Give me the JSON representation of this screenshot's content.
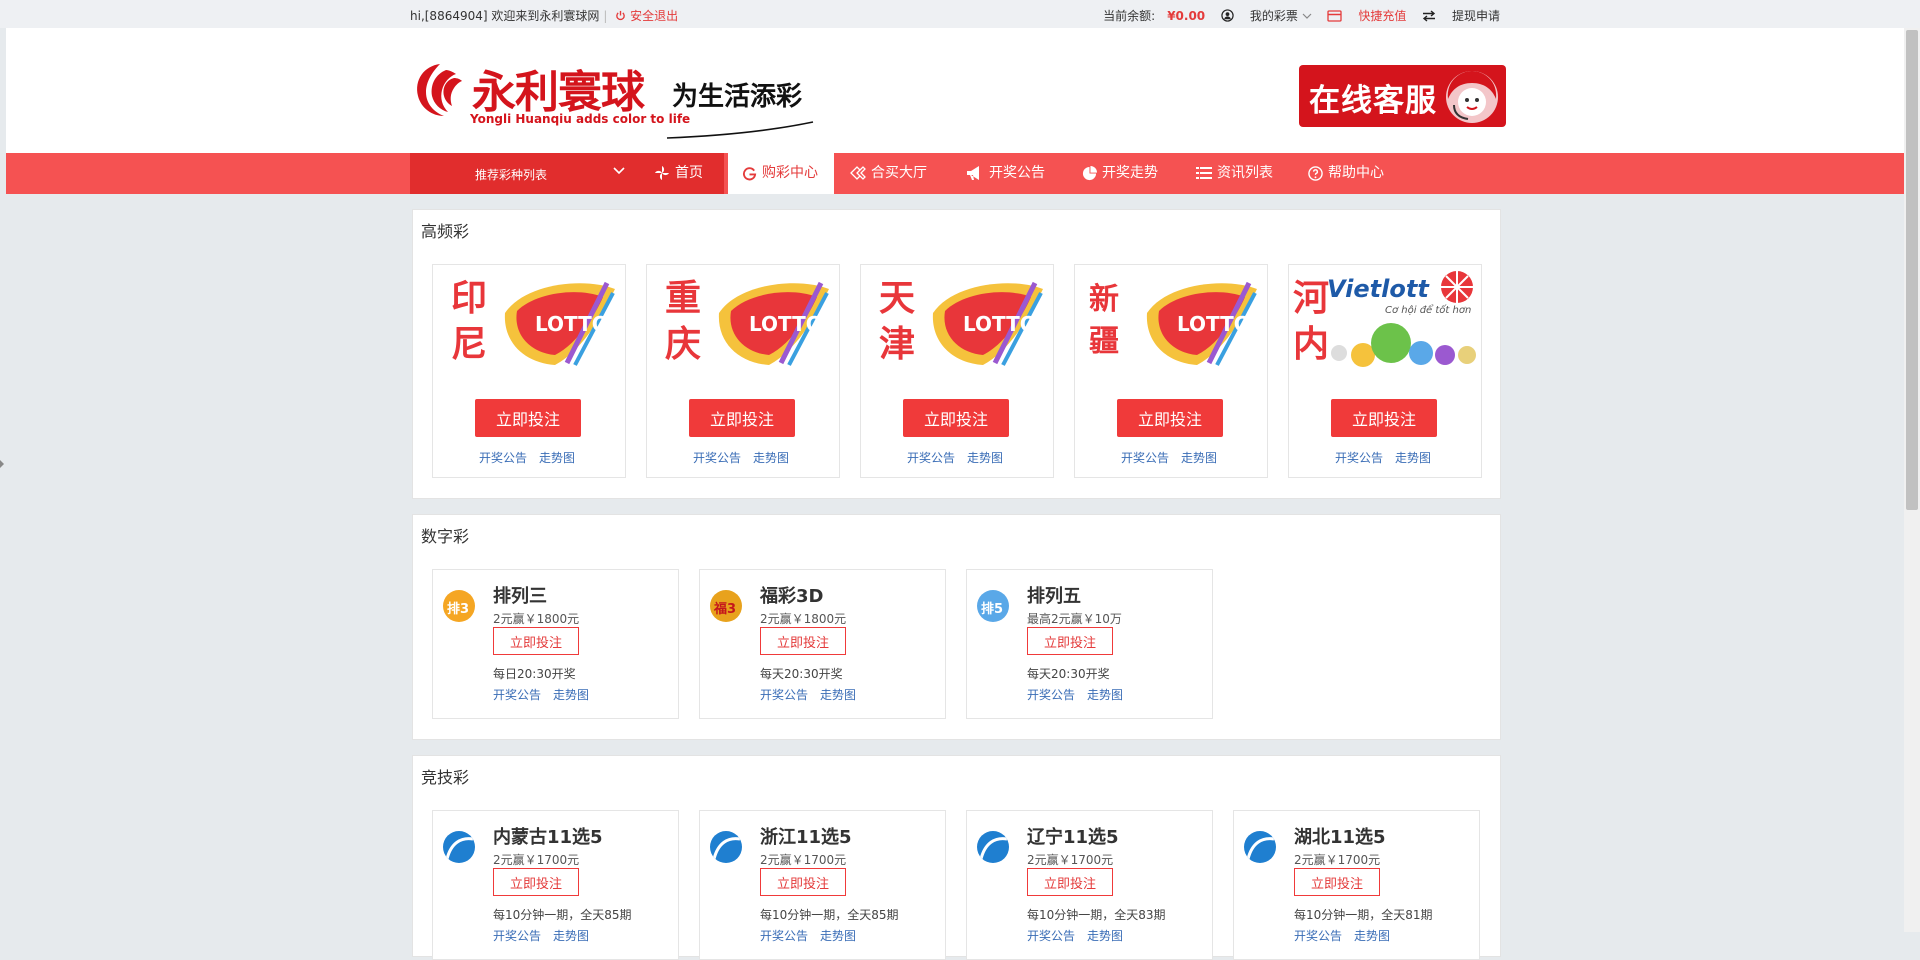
{
  "topbar": {
    "greeting": "hi,[8864904] 欢迎来到永利寰球网",
    "logout": "安全退出",
    "balance_label": "当前余额:",
    "balance_value": "¥0.00",
    "my_lottery": "我的彩票",
    "recharge": "快捷充值",
    "withdraw": "提现申请"
  },
  "logo": {
    "cn": "永利寰球",
    "en": "Yongli Huanqiu adds color to life",
    "slogan": "为生活添彩"
  },
  "service": {
    "label": "在线客服"
  },
  "nav": {
    "select_label": "推荐彩种列表",
    "items": [
      "首页",
      "购彩中心",
      "合买大厅",
      "开奖公告",
      "开奖走势",
      "资讯列表",
      "帮助中心"
    ]
  },
  "hf": {
    "title": "高频彩",
    "cards": [
      {
        "l1": "印",
        "l2": "尼",
        "btn": "立即投注",
        "a": "开奖公告",
        "b": "走势图"
      },
      {
        "l1": "重",
        "l2": "庆",
        "btn": "立即投注",
        "a": "开奖公告",
        "b": "走势图"
      },
      {
        "l1": "天",
        "l2": "津",
        "btn": "立即投注",
        "a": "开奖公告",
        "b": "走势图"
      },
      {
        "l1": "新",
        "l2": "疆",
        "btn": "立即投注",
        "a": "开奖公告",
        "b": "走势图"
      },
      {
        "l1": "河",
        "l2": "内",
        "btn": "立即投注",
        "a": "开奖公告",
        "b": "走势图",
        "brand": "Vietlott",
        "tag": "Cơ hội để tốt hơn"
      }
    ]
  },
  "num": {
    "title": "数字彩",
    "cards": [
      {
        "name": "排列三",
        "price": "2元赢￥1800元",
        "btn": "立即投注",
        "sched": "每日20:30开奖",
        "a": "开奖公告",
        "b": "走势图",
        "icon_text": "排3",
        "color": "#f5a623"
      },
      {
        "name": "福彩3D",
        "price": "2元赢￥1800元",
        "btn": "立即投注",
        "sched": "每天20:30开奖",
        "a": "开奖公告",
        "b": "走势图",
        "icon_text": "福3",
        "color": "#e8a21d"
      },
      {
        "name": "排列五",
        "price": "最高2元赢￥10万",
        "btn": "立即投注",
        "sched": "每天20:30开奖",
        "a": "开奖公告",
        "b": "走势图",
        "icon_text": "排5",
        "color": "#5aa8e8"
      }
    ]
  },
  "sport": {
    "title": "竞技彩",
    "cards": [
      {
        "name": "内蒙古11选5",
        "price": "2元赢￥1700元",
        "btn": "立即投注",
        "sched": "每10分钟一期，全天85期",
        "a": "开奖公告",
        "b": "走势图"
      },
      {
        "name": "浙江11选5",
        "price": "2元赢￥1700元",
        "btn": "立即投注",
        "sched": "每10分钟一期，全天85期",
        "a": "开奖公告",
        "b": "走势图"
      },
      {
        "name": "辽宁11选5",
        "price": "2元赢￥1700元",
        "btn": "立即投注",
        "sched": "每10分钟一期，全天83期",
        "a": "开奖公告",
        "b": "走势图"
      },
      {
        "name": "湖北11选5",
        "price": "2元赢￥1700元",
        "btn": "立即投注",
        "sched": "每10分钟一期，全天81期",
        "a": "开奖公告",
        "b": "走势图"
      }
    ]
  },
  "colors": {
    "brand_red": "#f55252",
    "dark_red": "#e12d2d",
    "link_blue": "#3a6db6"
  }
}
